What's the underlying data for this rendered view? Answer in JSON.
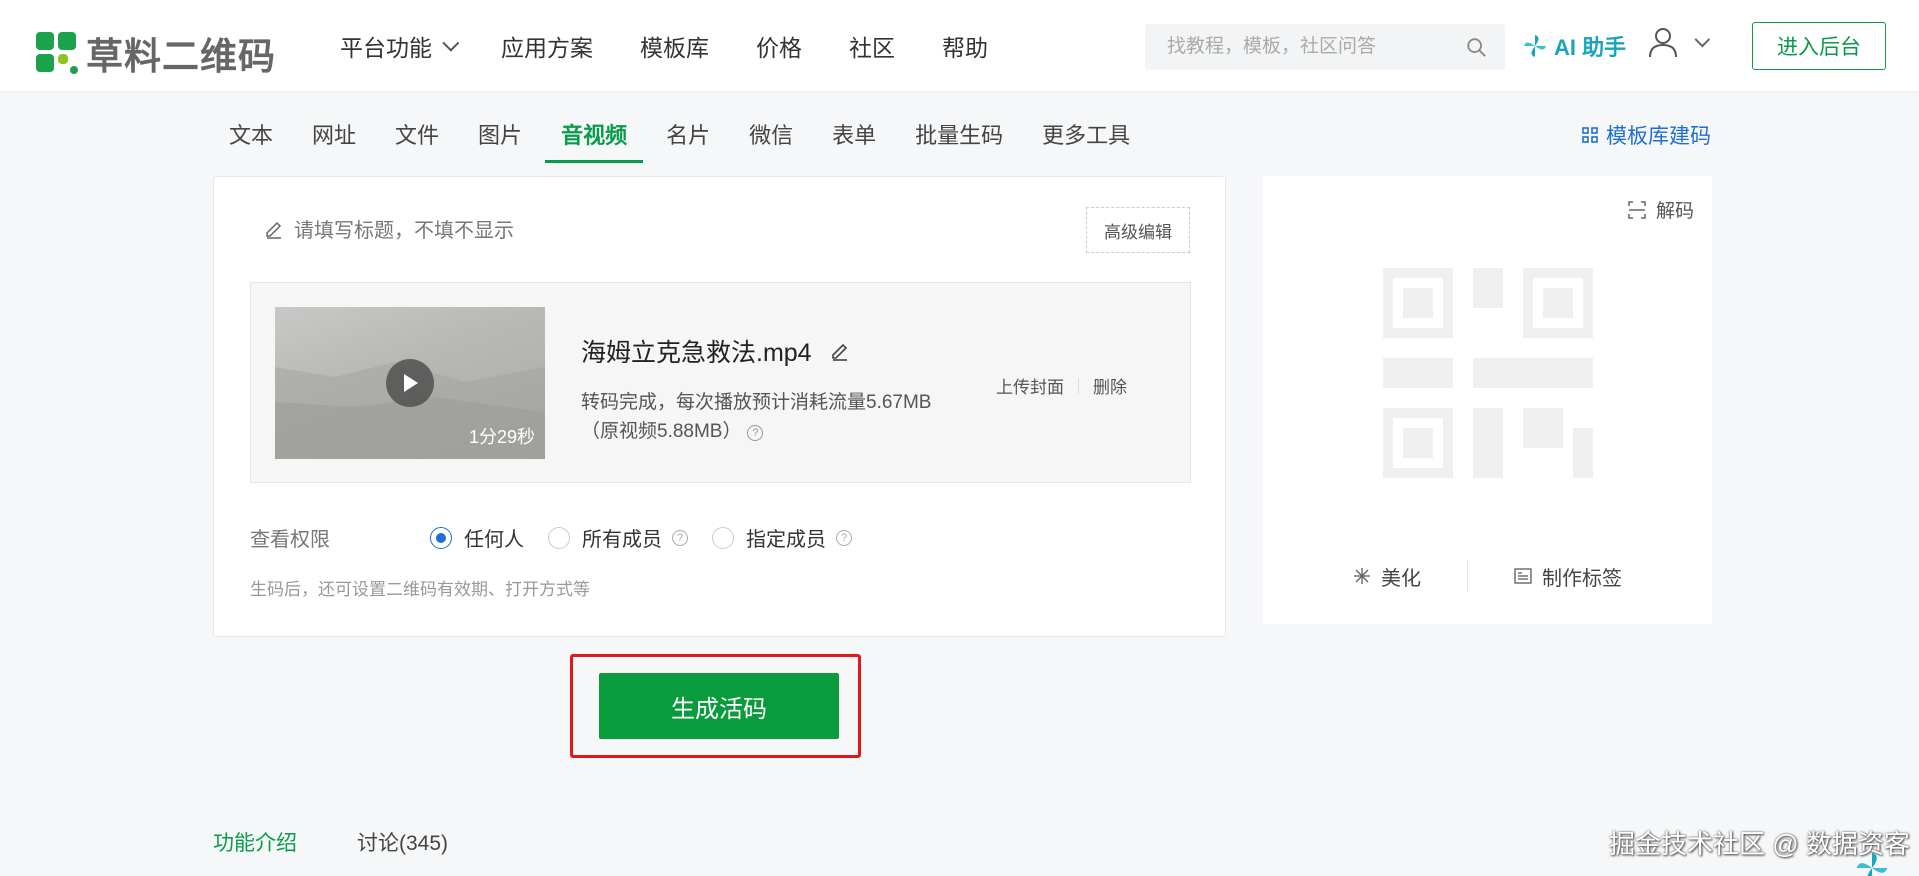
{
  "brand": {
    "name": "草料二维码",
    "colors": {
      "green": "#0a9b4a",
      "blue": "#1f6ed4",
      "teal": "#1aa5b8",
      "red": "#e0191c"
    }
  },
  "nav": {
    "items": [
      {
        "label": "平台功能",
        "has_dropdown": true
      },
      {
        "label": "应用方案"
      },
      {
        "label": "模板库"
      },
      {
        "label": "价格"
      },
      {
        "label": "社区"
      },
      {
        "label": "帮助"
      }
    ],
    "search_placeholder": "找教程，模板，社区问答",
    "ai_label": "AI 助手",
    "enter_label": "进入后台"
  },
  "tabs": {
    "items": [
      "文本",
      "网址",
      "文件",
      "图片",
      "音视频",
      "名片",
      "微信",
      "表单",
      "批量生码",
      "更多工具"
    ],
    "active": "音视频",
    "template_link": "模板库建码"
  },
  "editor": {
    "title_placeholder": "请填写标题，不填不显示",
    "advanced_label": "高级编辑",
    "video": {
      "duration": "1分29秒",
      "filename": "海姆立克急救法.mp4",
      "status_line1": "转码完成，每次播放预计消耗流量5.67MB",
      "status_line2": "（原视频5.88MB）",
      "upload_cover": "上传封面",
      "delete": "删除"
    },
    "permission": {
      "label": "查看权限",
      "options": [
        "任何人",
        "所有成员",
        "指定成员"
      ],
      "selected": "任何人"
    },
    "hint": "生码后，还可设置二维码有效期、打开方式等"
  },
  "generate_label": "生成活码",
  "qr_panel": {
    "decode_label": "解码",
    "beautify_label": "美化",
    "label_label": "制作标签"
  },
  "bottom_tabs": [
    "功能介绍",
    "讨论(345)"
  ],
  "watermark": "掘金技术社区 @ 数据资客"
}
